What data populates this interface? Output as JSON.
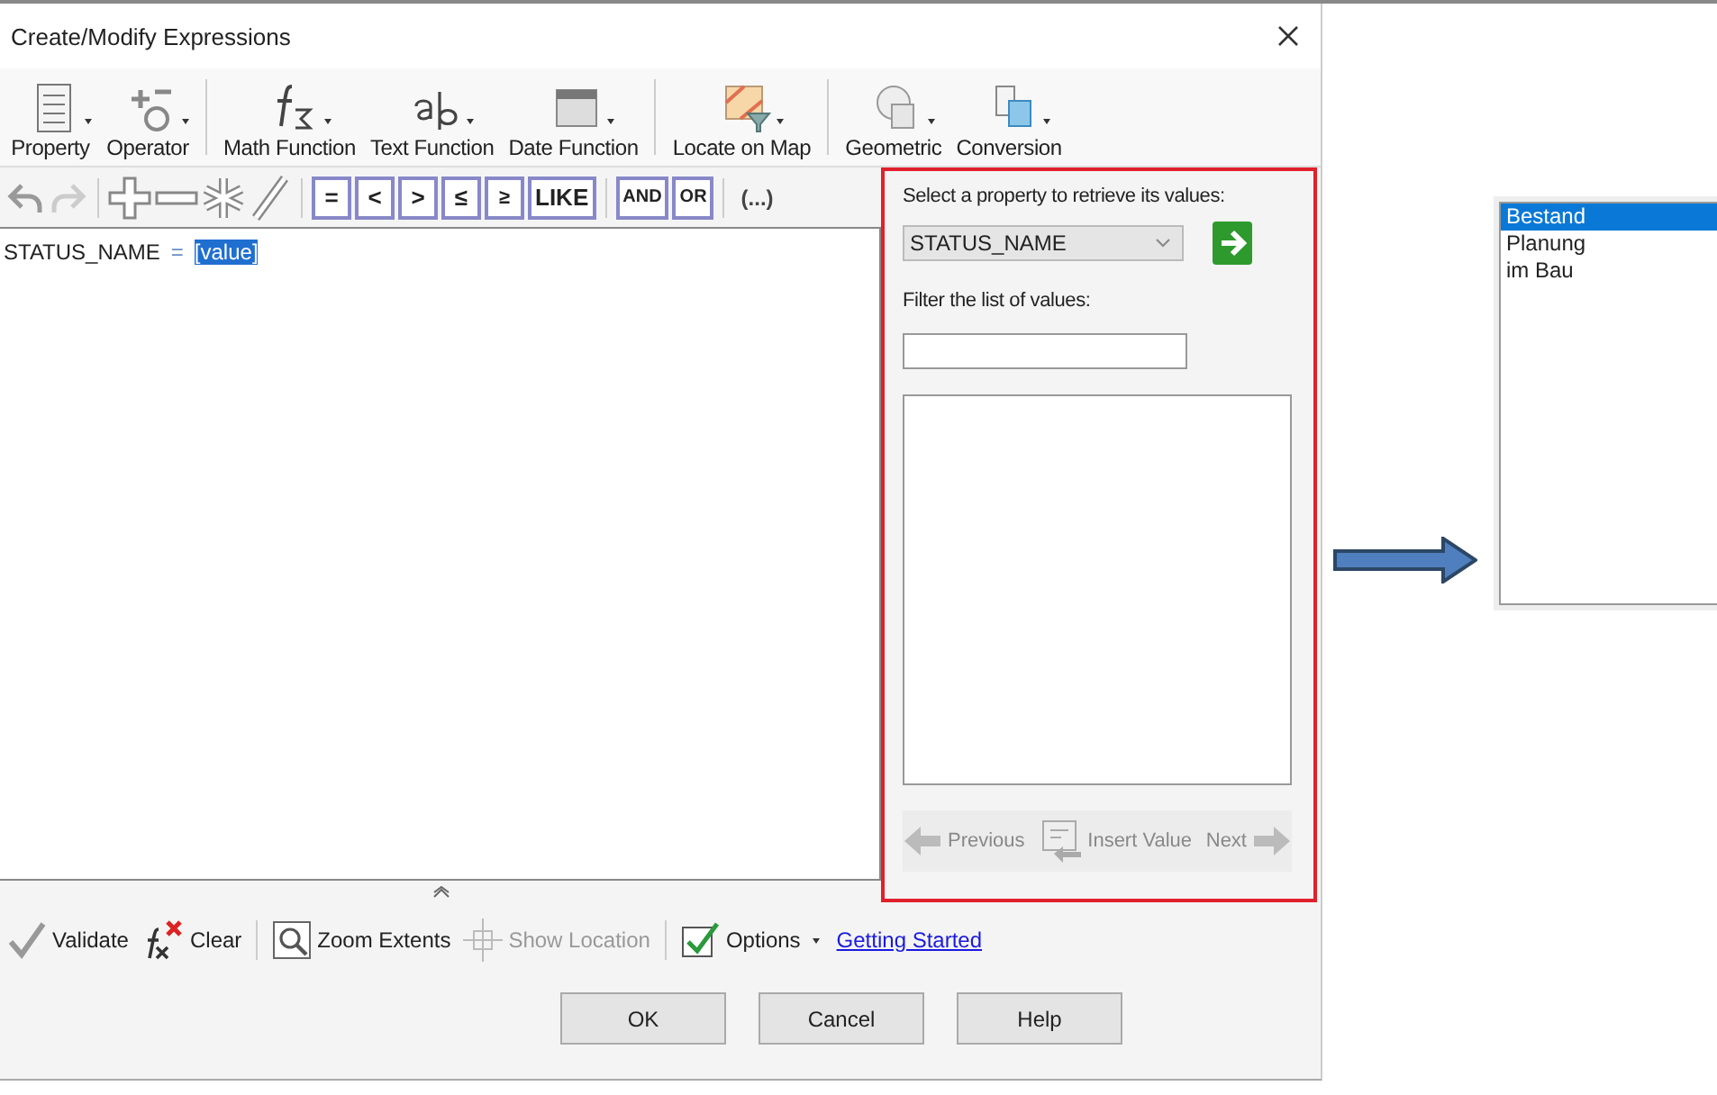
{
  "window": {
    "title": "Create/Modify Expressions"
  },
  "ribbon": [
    {
      "label": "Property"
    },
    {
      "label": "Operator"
    },
    {
      "label": "Math Function"
    },
    {
      "label": "Text Function"
    },
    {
      "label": "Date Function"
    },
    {
      "label": "Locate on Map"
    },
    {
      "label": "Geometric"
    },
    {
      "label": "Conversion"
    }
  ],
  "comparison_operators": [
    "=",
    "<",
    ">",
    "≤",
    "≥",
    "LIKE"
  ],
  "logical_operators": [
    "AND",
    "OR"
  ],
  "grouping": "(...)",
  "expression": {
    "property": "STATUS_NAME",
    "operator": "=",
    "value": "[value]",
    "value_selected": true
  },
  "values_panel": {
    "prompt": "Select a property to retrieve its values:",
    "property_select": "STATUS_NAME",
    "filter_label": "Filter the list of values:",
    "nav": [
      {
        "label": "Previous",
        "disabled": true
      },
      {
        "label": "Insert Value",
        "disabled": true
      },
      {
        "label": "Next",
        "disabled": true
      }
    ]
  },
  "bottom_toolbar": [
    {
      "label": "Validate",
      "disabled": false
    },
    {
      "label": "Clear",
      "disabled": false
    },
    {
      "label": "Zoom Extents",
      "disabled": false
    },
    {
      "label": "Show Location",
      "disabled": true
    },
    {
      "label": "Options",
      "disabled": false
    }
  ],
  "link": "Getting Started",
  "buttons": [
    "OK",
    "Cancel",
    "Help"
  ],
  "value_list": [
    {
      "label": "Bestand",
      "selected": true
    },
    {
      "label": "Planung",
      "selected": false
    },
    {
      "label": "im Bau",
      "selected": false
    }
  ]
}
